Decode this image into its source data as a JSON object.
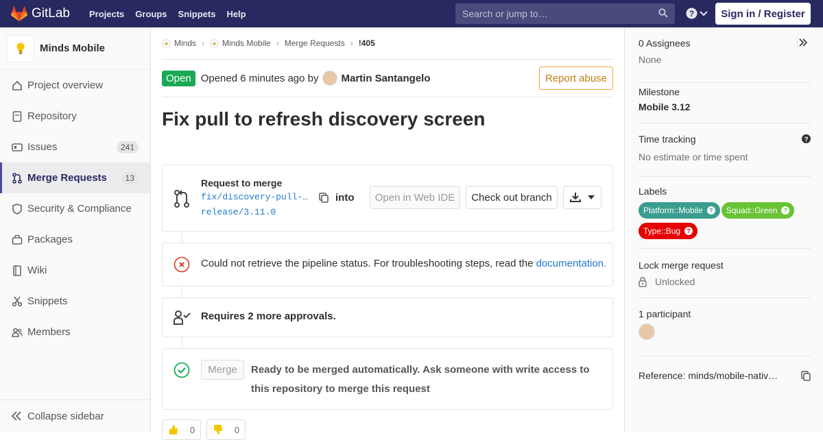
{
  "navbar": {
    "brand": "GitLab",
    "links": [
      "Projects",
      "Groups",
      "Snippets",
      "Help"
    ],
    "search_placeholder": "Search or jump to…",
    "signin": "Sign in / Register"
  },
  "sidebar": {
    "project_name": "Minds Mobile",
    "items": [
      {
        "label": "Project overview",
        "icon": "home-icon"
      },
      {
        "label": "Repository",
        "icon": "doc-icon"
      },
      {
        "label": "Issues",
        "icon": "issues-icon",
        "count": "241"
      },
      {
        "label": "Merge Requests",
        "icon": "merge-request-icon",
        "count": "13",
        "active": true
      },
      {
        "label": "Security & Compliance",
        "icon": "shield-icon"
      },
      {
        "label": "Packages",
        "icon": "package-icon"
      },
      {
        "label": "Wiki",
        "icon": "book-icon"
      },
      {
        "label": "Snippets",
        "icon": "scissors-icon"
      },
      {
        "label": "Members",
        "icon": "users-icon"
      }
    ],
    "collapse_label": "Collapse sidebar"
  },
  "breadcrumb": [
    "Minds",
    "Minds Mobile",
    "Merge Requests",
    "!405"
  ],
  "mr": {
    "status": "Open",
    "opened_text": "Opened 6 minutes ago by",
    "author": "Martin Santangelo",
    "report_label": "Report abuse",
    "title": "Fix pull to refresh discovery screen",
    "request_to_merge": "Request to merge",
    "source_branch": "fix/discovery-pull-…",
    "into": "into",
    "target_branch": "release/3.11.0",
    "open_web_ide": "Open in Web IDE",
    "checkout_branch": "Check out branch",
    "pipeline_text": "Could not retrieve the pipeline status. For troubleshooting steps, read the",
    "pipeline_link": "documentation.",
    "approvals_text": "Requires 2 more approvals.",
    "merge_button": "Merge",
    "ready_text": "Ready to be merged automatically. Ask someone with write access to this repository to merge this request",
    "thumbs_up": "0",
    "thumbs_down": "0"
  },
  "right_sidebar": {
    "assignees_title": "0 Assignees",
    "assignees_value": "None",
    "milestone_title": "Milestone",
    "milestone_value": "Mobile 3.12",
    "time_tracking_title": "Time tracking",
    "time_tracking_value": "No estimate or time spent",
    "labels_title": "Labels",
    "labels": [
      {
        "text": "Platform::Mobile",
        "color": "#3a9d8f"
      },
      {
        "text": "Squad::Green",
        "color": "#69c335"
      },
      {
        "text": "Type::Bug",
        "color": "#e60000"
      }
    ],
    "lock_title": "Lock merge request",
    "lock_value": "Unlocked",
    "participants_title": "1 participant",
    "reference": "Reference: minds/mobile-nativ…"
  },
  "colors": {
    "navbar": "#292961",
    "open_green": "#1aaa55",
    "link_blue": "#1f78d1"
  }
}
